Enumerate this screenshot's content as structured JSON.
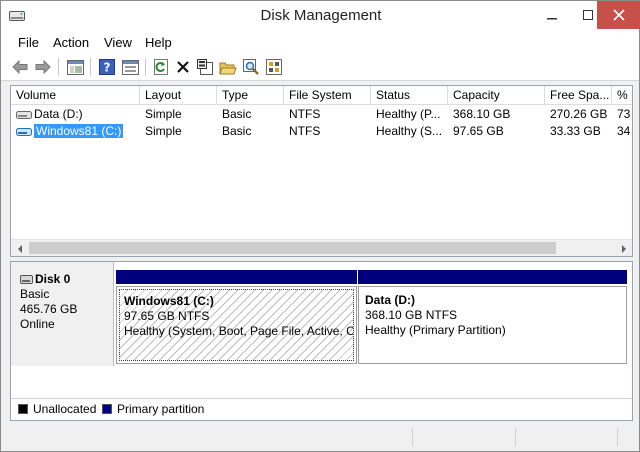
{
  "window": {
    "title": "Disk Management",
    "colors": {
      "close": "#c7504b",
      "accent": "#00007f",
      "selection": "#3399ff"
    }
  },
  "menubar": {
    "items": [
      {
        "label": "File"
      },
      {
        "label": "Action"
      },
      {
        "label": "View"
      },
      {
        "label": "Help"
      }
    ]
  },
  "toolbar": {
    "icons": [
      "back-arrow-icon",
      "forward-arrow-icon",
      "console-tree-icon",
      "help-icon",
      "help-topics-icon",
      "refresh-icon",
      "delete-icon",
      "properties-icon",
      "open-folder-icon",
      "search-icon",
      "snapin-icon"
    ]
  },
  "volume_list": {
    "columns": [
      "Volume",
      "Layout",
      "Type",
      "File System",
      "Status",
      "Capacity",
      "Free Spa...",
      "% F"
    ],
    "rows": [
      {
        "volume": "Data (D:)",
        "layout": "Simple",
        "type": "Basic",
        "fs": "NTFS",
        "status": "Healthy (P...",
        "capacity": "368.10 GB",
        "free": "270.26 GB",
        "pct": "73",
        "selected": false
      },
      {
        "volume": "Windows81 (C:)",
        "layout": "Simple",
        "type": "Basic",
        "fs": "NTFS",
        "status": "Healthy (S...",
        "capacity": "97.65 GB",
        "free": "33.33 GB",
        "pct": "34",
        "selected": true
      }
    ]
  },
  "disk": {
    "name": "Disk 0",
    "type": "Basic",
    "size": "465.76 GB",
    "status": "Online",
    "partitions": [
      {
        "name": "Windows81  (C:)",
        "size_fs": "97.65 GB NTFS",
        "status": "Healthy (System, Boot, Page File, Active, Cr"
      },
      {
        "name": "Data  (D:)",
        "size_fs": "368.10 GB NTFS",
        "status": "Healthy (Primary Partition)"
      }
    ]
  },
  "legend": {
    "items": [
      {
        "label": "Unallocated",
        "color": "#000000"
      },
      {
        "label": "Primary partition",
        "color": "#00007f"
      }
    ]
  }
}
